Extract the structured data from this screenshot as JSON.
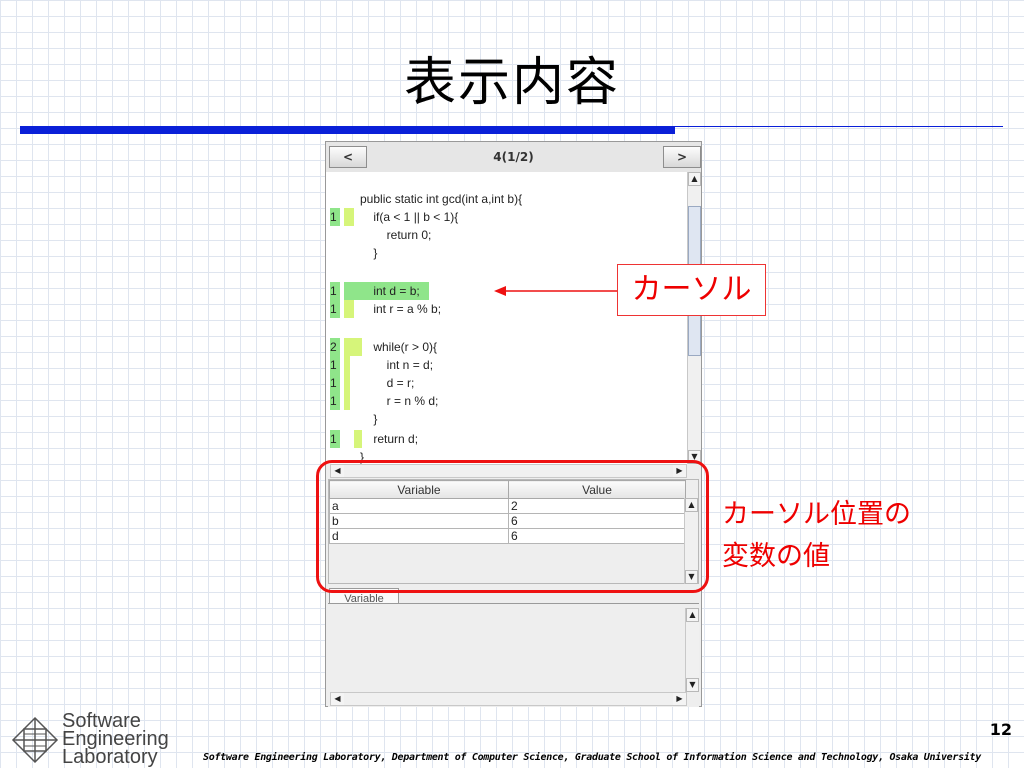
{
  "slide": {
    "title": "表示内容",
    "page_number": "12",
    "footer": "Software Engineering Laboratory, Department of Computer Science, Graduate School of Information Science and Technology, Osaka University",
    "logo_lines": [
      "Software",
      "Engineering",
      "Laboratory"
    ]
  },
  "app": {
    "prev_label": "<",
    "next_label": ">",
    "page_label": "4(1/2)",
    "code_lines": [
      {
        "count": "",
        "text": "public static int gcd(int a,int b){"
      },
      {
        "count": "1",
        "text": "    if(a < 1 || b < 1){"
      },
      {
        "count": "",
        "text": "        return 0;"
      },
      {
        "count": "",
        "text": "    }"
      },
      {
        "count": "",
        "text": ""
      },
      {
        "count": "1",
        "text": "    int d = b;"
      },
      {
        "count": "1",
        "text": "    int r = a % b;"
      },
      {
        "count": "",
        "text": ""
      },
      {
        "count": "2",
        "text": "    while(r > 0){"
      },
      {
        "count": "1",
        "text": "        int n = d;"
      },
      {
        "count": "1",
        "text": "        d = r;"
      },
      {
        "count": "1",
        "text": "        r = n % d;"
      },
      {
        "count": "",
        "text": "    }"
      },
      {
        "count": "1",
        "text": "    return d;"
      },
      {
        "count": "",
        "text": "}"
      }
    ],
    "variables": {
      "headers": [
        "Variable",
        "Value"
      ],
      "rows": [
        [
          "a",
          "2"
        ],
        [
          "b",
          "6"
        ],
        [
          "d",
          "6"
        ]
      ]
    },
    "tab_label": "Variable"
  },
  "annotations": {
    "cursor_label": "カーソル",
    "cursor_values_line1": "カーソル位置の",
    "cursor_values_line2": "変数の値",
    "accent_color": "#ee0000",
    "title_bar_color": "#0a20d8",
    "highlight_color": "#8fe58a"
  }
}
